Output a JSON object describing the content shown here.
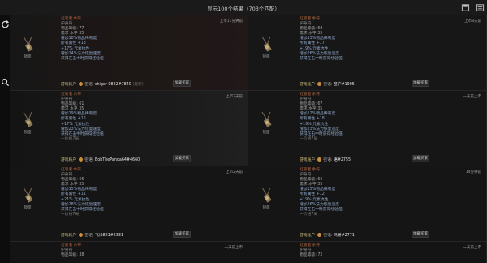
{
  "header": {
    "title": "显示100个结果（703个匹配）"
  },
  "icons": {
    "refresh": "refresh-icon",
    "search": "search-icon",
    "save": "save-icon",
    "settings": "settings-icon",
    "menu": "menu-icon"
  },
  "colors": {
    "accent": "#b0643f",
    "mod": "#8fa6c9",
    "background": "#0d0d0d"
  },
  "results": [
    {
      "name_a": "虹吸者",
      "name_b": "余符",
      "base_type": "护身符",
      "ilvl_label": "物品等级:",
      "ilvl": "77",
      "req_label": "需求 水平",
      "req": "35",
      "imp": "增加18%物品稀有度",
      "mods": [
        "所有属性 +13",
        "+17% 元素抗性",
        "增加24%法力恢复速度",
        "获得在击中时获得经验值"
      ],
      "extra": "",
      "time": "上市11分钟前",
      "seller_label": "游戏账户",
      "seller_ghost": "",
      "whisper": "密语:",
      "account": "shiger 0822#7840",
      "account_extra": "(最新)",
      "button": "加载买家",
      "item_label": "镜面"
    },
    {
      "name_a": "虹吸者",
      "name_b": "余符",
      "base_type": "护身符",
      "ilvl_label": "物品等级:",
      "ilvl": "68",
      "req_label": "需求 水平",
      "req": "35",
      "imp": "增加13%物品稀有度",
      "mods": [
        "所有属性 +17",
        "+19% 元素抗性",
        "增加26%法力恢复速度",
        "获得在击中时获得经验值"
      ],
      "extra": "",
      "time": "上市8天前",
      "seller_label": "游戏账户",
      "seller_ghost": "",
      "whisper": "密语:",
      "account": "苗沪#1905",
      "account_extra": "",
      "button": "加载买家",
      "item_label": "镜面"
    },
    {
      "name_a": "虹吸者",
      "name_b": "余符",
      "base_type": "护身符",
      "ilvl_label": "物品等级:",
      "ilvl": "61",
      "req_label": "需求 水平",
      "req": "35",
      "imp": "增加19%物品稀有度",
      "mods": [
        "所有属性 +15",
        "+17% 元素抗性",
        "增加23%法力恢复速度",
        "获得在击中时获得经验值"
      ],
      "extra": "一价格7局",
      "time": "上市2天前",
      "seller_label": "游戏账户",
      "seller_ghost": "",
      "whisper": "密语:",
      "account": "BobThePanda64#4660",
      "account_extra": "",
      "button": "加载买家",
      "item_label": "镜面"
    },
    {
      "name_a": "虹吸者",
      "name_b": "余符",
      "base_type": "护身符",
      "ilvl_label": "物品等级:",
      "ilvl": "67",
      "req_label": "需求 水平",
      "req": "35",
      "imp": "增加12%物品稀有度",
      "mods": [
        "所有属性 +18",
        "+19% 元素抗性",
        "增加23%法力恢复速度",
        "获得在击中时获得经验值"
      ],
      "extra": "一价格7局",
      "time": "一天前上市",
      "seller_label": "游戏账户",
      "seller_ghost": "",
      "whisper": "密语:",
      "account": "语#2755",
      "account_extra": "",
      "button": "加载买家",
      "item_label": "镜面"
    },
    {
      "name_a": "虹吸者",
      "name_b": "余符",
      "base_type": "护身符",
      "ilvl_label": "物品等级:",
      "ilvl": "66",
      "req_label": "需求 水平",
      "req": "35",
      "imp": "增加15%物品稀有度",
      "mods": [
        "所有属性 +11",
        "+21% 元素抗性",
        "增加28%法力恢复速度",
        "获得在击中时获得经验值"
      ],
      "extra": "一价格7局",
      "time": "上市2天前",
      "seller_label": "游戏账户",
      "seller_ghost": "",
      "whisper": "密语:",
      "account": "飞洋821#6331",
      "account_extra": "",
      "button": "加载买家",
      "item_label": "镜面"
    },
    {
      "name_a": "虹吸者",
      "name_b": "余符",
      "base_type": "护身符",
      "ilvl_label": "物品等级:",
      "ilvl": "66",
      "req_label": "需求 水平",
      "req": "35",
      "imp": "增加15%物品稀有度",
      "mods": [
        "所有属性 +12",
        "+19% 元素抗性",
        "增加26%法力恢复速度",
        "获得在击中时获得经验值"
      ],
      "extra": "一价格7局",
      "time": "14分钟前",
      "seller_label": "游戏账户",
      "seller_ghost": "",
      "whisper": "密语:",
      "account": "鸡爵#2771",
      "account_extra": "",
      "button": "加载买家",
      "item_label": "镜面"
    },
    {
      "name_a": "虹吸者",
      "name_b": "余符",
      "base_type": "护身符",
      "ilvl_label": "物品等级:",
      "ilvl": "38",
      "time": "一天前上市"
    },
    {
      "name_a": "虹吸者",
      "name_b": "余符",
      "base_type": "护身符",
      "ilvl_label": "物品等级:",
      "ilvl": "72",
      "time": "一天前上市"
    }
  ]
}
